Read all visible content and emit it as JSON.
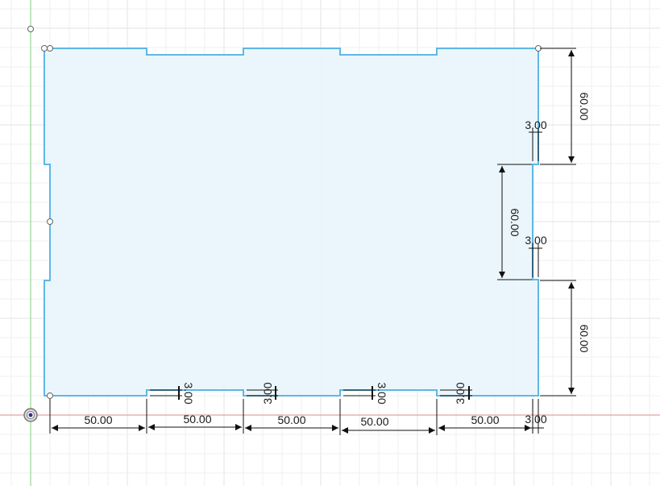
{
  "colors": {
    "background": "#ffffff",
    "grid_minor": "#eef0f2",
    "grid_major": "#dfe3e7",
    "x_axis": "#e08a8a",
    "y_axis": "#7fd17f",
    "profile_stroke": "#5fb7e6",
    "profile_fill": "#e9f5fc",
    "dimension": "#111111",
    "origin_ring": "#7a7a7a",
    "origin_dot": "#3a2f8f"
  },
  "icons": {
    "origin": "origin-point-icon",
    "point": "sketch-point-icon"
  },
  "dimensions": {
    "top_right_height": "60.00",
    "right_notch_height": "60.00",
    "bottom_right_height": "60.00",
    "right_notch_depth_upper": "3.00",
    "right_notch_depth_lower": "3.00",
    "bottom_tab_depth_1": "3.00",
    "bottom_tab_depth_2": "3.00",
    "bottom_tab_depth_3": "3.00",
    "bottom_tab_depth_4": "3.00",
    "bottom_width_1": "50.00",
    "bottom_width_2": "50.00",
    "bottom_width_3": "50.00",
    "bottom_width_4": "50.00",
    "bottom_width_5": "50.00",
    "bottom_end_depth": "3.00"
  }
}
